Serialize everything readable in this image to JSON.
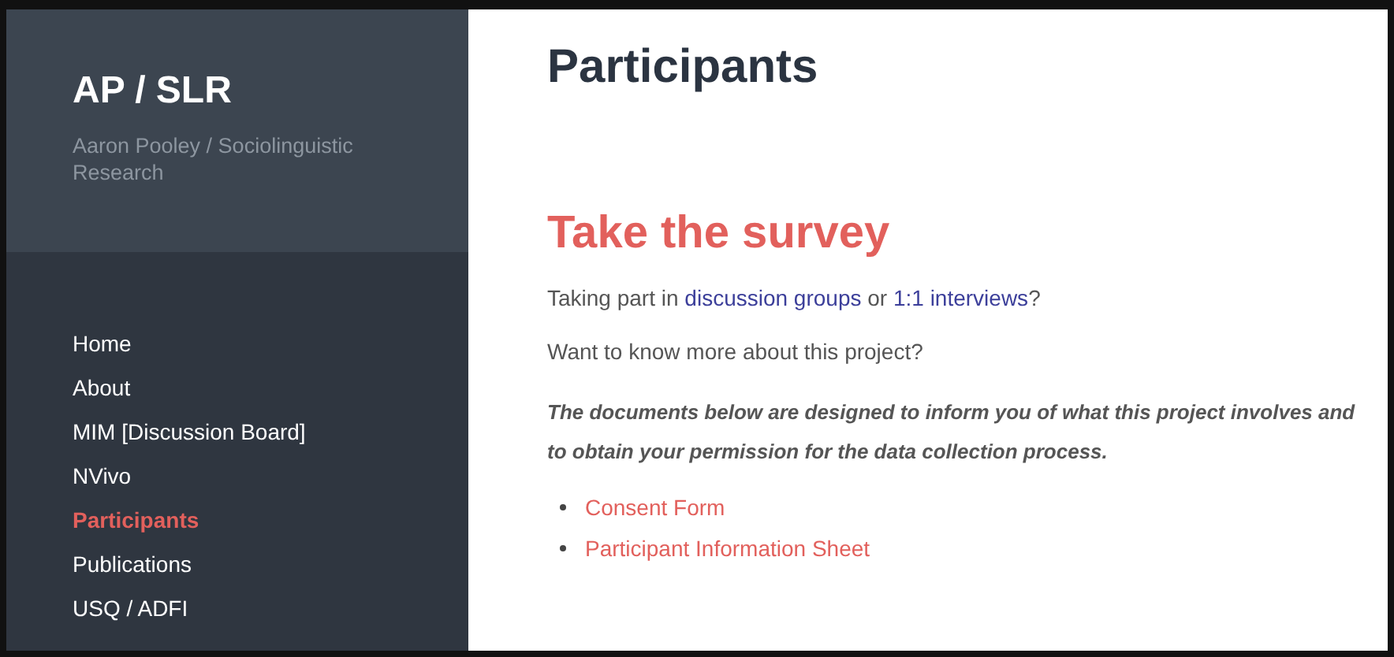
{
  "site": {
    "title": "AP / SLR",
    "subtitle": "Aaron Pooley / Sociolinguistic Research"
  },
  "nav": [
    {
      "label": "Home",
      "selected": false
    },
    {
      "label": "About",
      "selected": false
    },
    {
      "label": "MIM [Discussion Board]",
      "selected": false
    },
    {
      "label": "NVivo",
      "selected": false
    },
    {
      "label": "Participants",
      "selected": true
    },
    {
      "label": "Publications",
      "selected": false
    },
    {
      "label": "USQ / ADFI",
      "selected": false
    }
  ],
  "page_title": "Participants",
  "heading": "Take the survey",
  "intro": [
    {
      "kind": "text",
      "text": "Taking part in "
    },
    {
      "kind": "link",
      "text": "discussion groups"
    },
    {
      "kind": "text",
      "text": " or "
    },
    {
      "kind": "link",
      "text": "1:1 interviews"
    },
    {
      "kind": "text",
      "text": "?"
    }
  ],
  "question": "Want to know more about this project?",
  "note": "The documents below are designed to inform you of what this project involves and to obtain your permission for the data collection process.",
  "documents": [
    "Consent Form",
    "Participant Information Sheet"
  ]
}
